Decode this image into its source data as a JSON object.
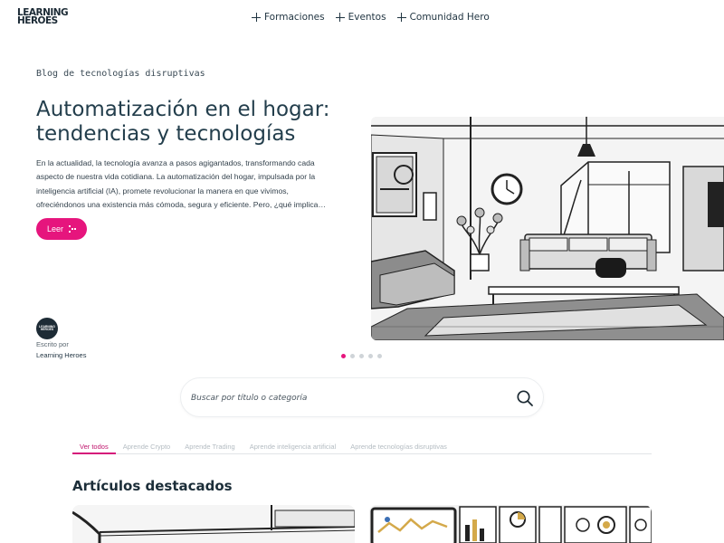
{
  "brand": {
    "line1": "LEARNING",
    "line2": "HEROES"
  },
  "nav": {
    "items": [
      {
        "label": "Formaciones"
      },
      {
        "label": "Eventos"
      },
      {
        "label": "Comunidad Hero"
      }
    ]
  },
  "hero": {
    "eyebrow": "Blog de tecnologías disruptivas",
    "title": "Automatización en el hogar: tendencias y tecnologías",
    "excerpt": "En la actualidad, la tecnología avanza a pasos agigantados, transformando cada aspecto de nuestra vida cotidiana. La automatización del hogar, impulsada por la inteligencia artificial (IA), promete revolucionar la manera en que vivimos, ofreciéndonos una existencia más cómoda, segura y eficiente. Pero, ¿qué implica…",
    "read_label": "Leer",
    "author_label": "Escrito por",
    "author_name": "Learning Heroes",
    "avatar_line1": "LEARNING",
    "avatar_line2": "HEROES",
    "slide_count": 5,
    "active_slide": 1
  },
  "search": {
    "placeholder": "Buscar por título o categoría"
  },
  "tabs": [
    {
      "label": "Ver todos",
      "active": true
    },
    {
      "label": "Aprende Crypto",
      "active": false
    },
    {
      "label": "Aprende Trading",
      "active": false
    },
    {
      "label": "Aprende inteligencia artificial",
      "active": false
    },
    {
      "label": "Aprende tecnologías disruptivas",
      "active": false
    }
  ],
  "featured": {
    "title": "Artículos destacados"
  },
  "colors": {
    "accent": "#e6157d",
    "text": "#233e4c"
  }
}
